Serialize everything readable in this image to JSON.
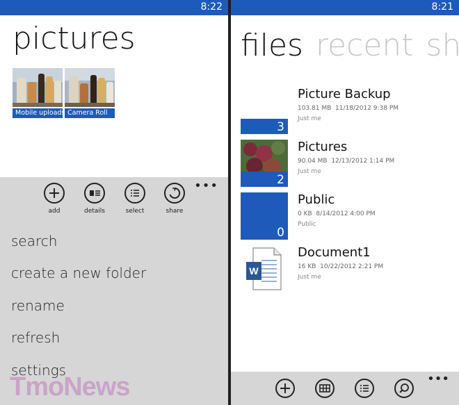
{
  "left": {
    "status_time": "8:22",
    "title": "pictures",
    "albums": [
      {
        "label": "Mobile uploads"
      },
      {
        "label": "Camera Roll"
      }
    ],
    "appbar": {
      "more": "•••",
      "buttons": [
        {
          "label": "add",
          "icon": "plus-icon"
        },
        {
          "label": "details",
          "icon": "details-icon"
        },
        {
          "label": "select",
          "icon": "select-list-icon"
        },
        {
          "label": "share",
          "icon": "share-icon"
        }
      ],
      "menu_items": [
        "search",
        "create a new folder",
        "rename",
        "refresh",
        "settings"
      ]
    },
    "watermark": "TmoNews"
  },
  "right": {
    "status_time": "8:21",
    "pivot": [
      "files",
      "recent",
      "sha"
    ],
    "files": [
      {
        "name": "Picture Backup",
        "size": "103.81 MB",
        "date": "11/18/2012 9:38 PM",
        "sharing": "Just me",
        "count": "3"
      },
      {
        "name": "Pictures",
        "size": "90.04 MB",
        "date": "12/13/2012 1:14 PM",
        "sharing": "Just me",
        "count": "2"
      },
      {
        "name": "Public",
        "size": "0 KB",
        "date": "8/14/2012 4:00 PM",
        "sharing": "Public",
        "count": "0"
      },
      {
        "name": "Document1",
        "size": "16 KB",
        "date": "10/22/2012 2:21 PM",
        "sharing": "Just me",
        "icon": "word-document-icon"
      }
    ],
    "bottom_more": "•••"
  },
  "colors": {
    "accent": "#1d5aba",
    "appbar": "#d6d6d6",
    "inactive_pivot": "#c8c8c8"
  }
}
